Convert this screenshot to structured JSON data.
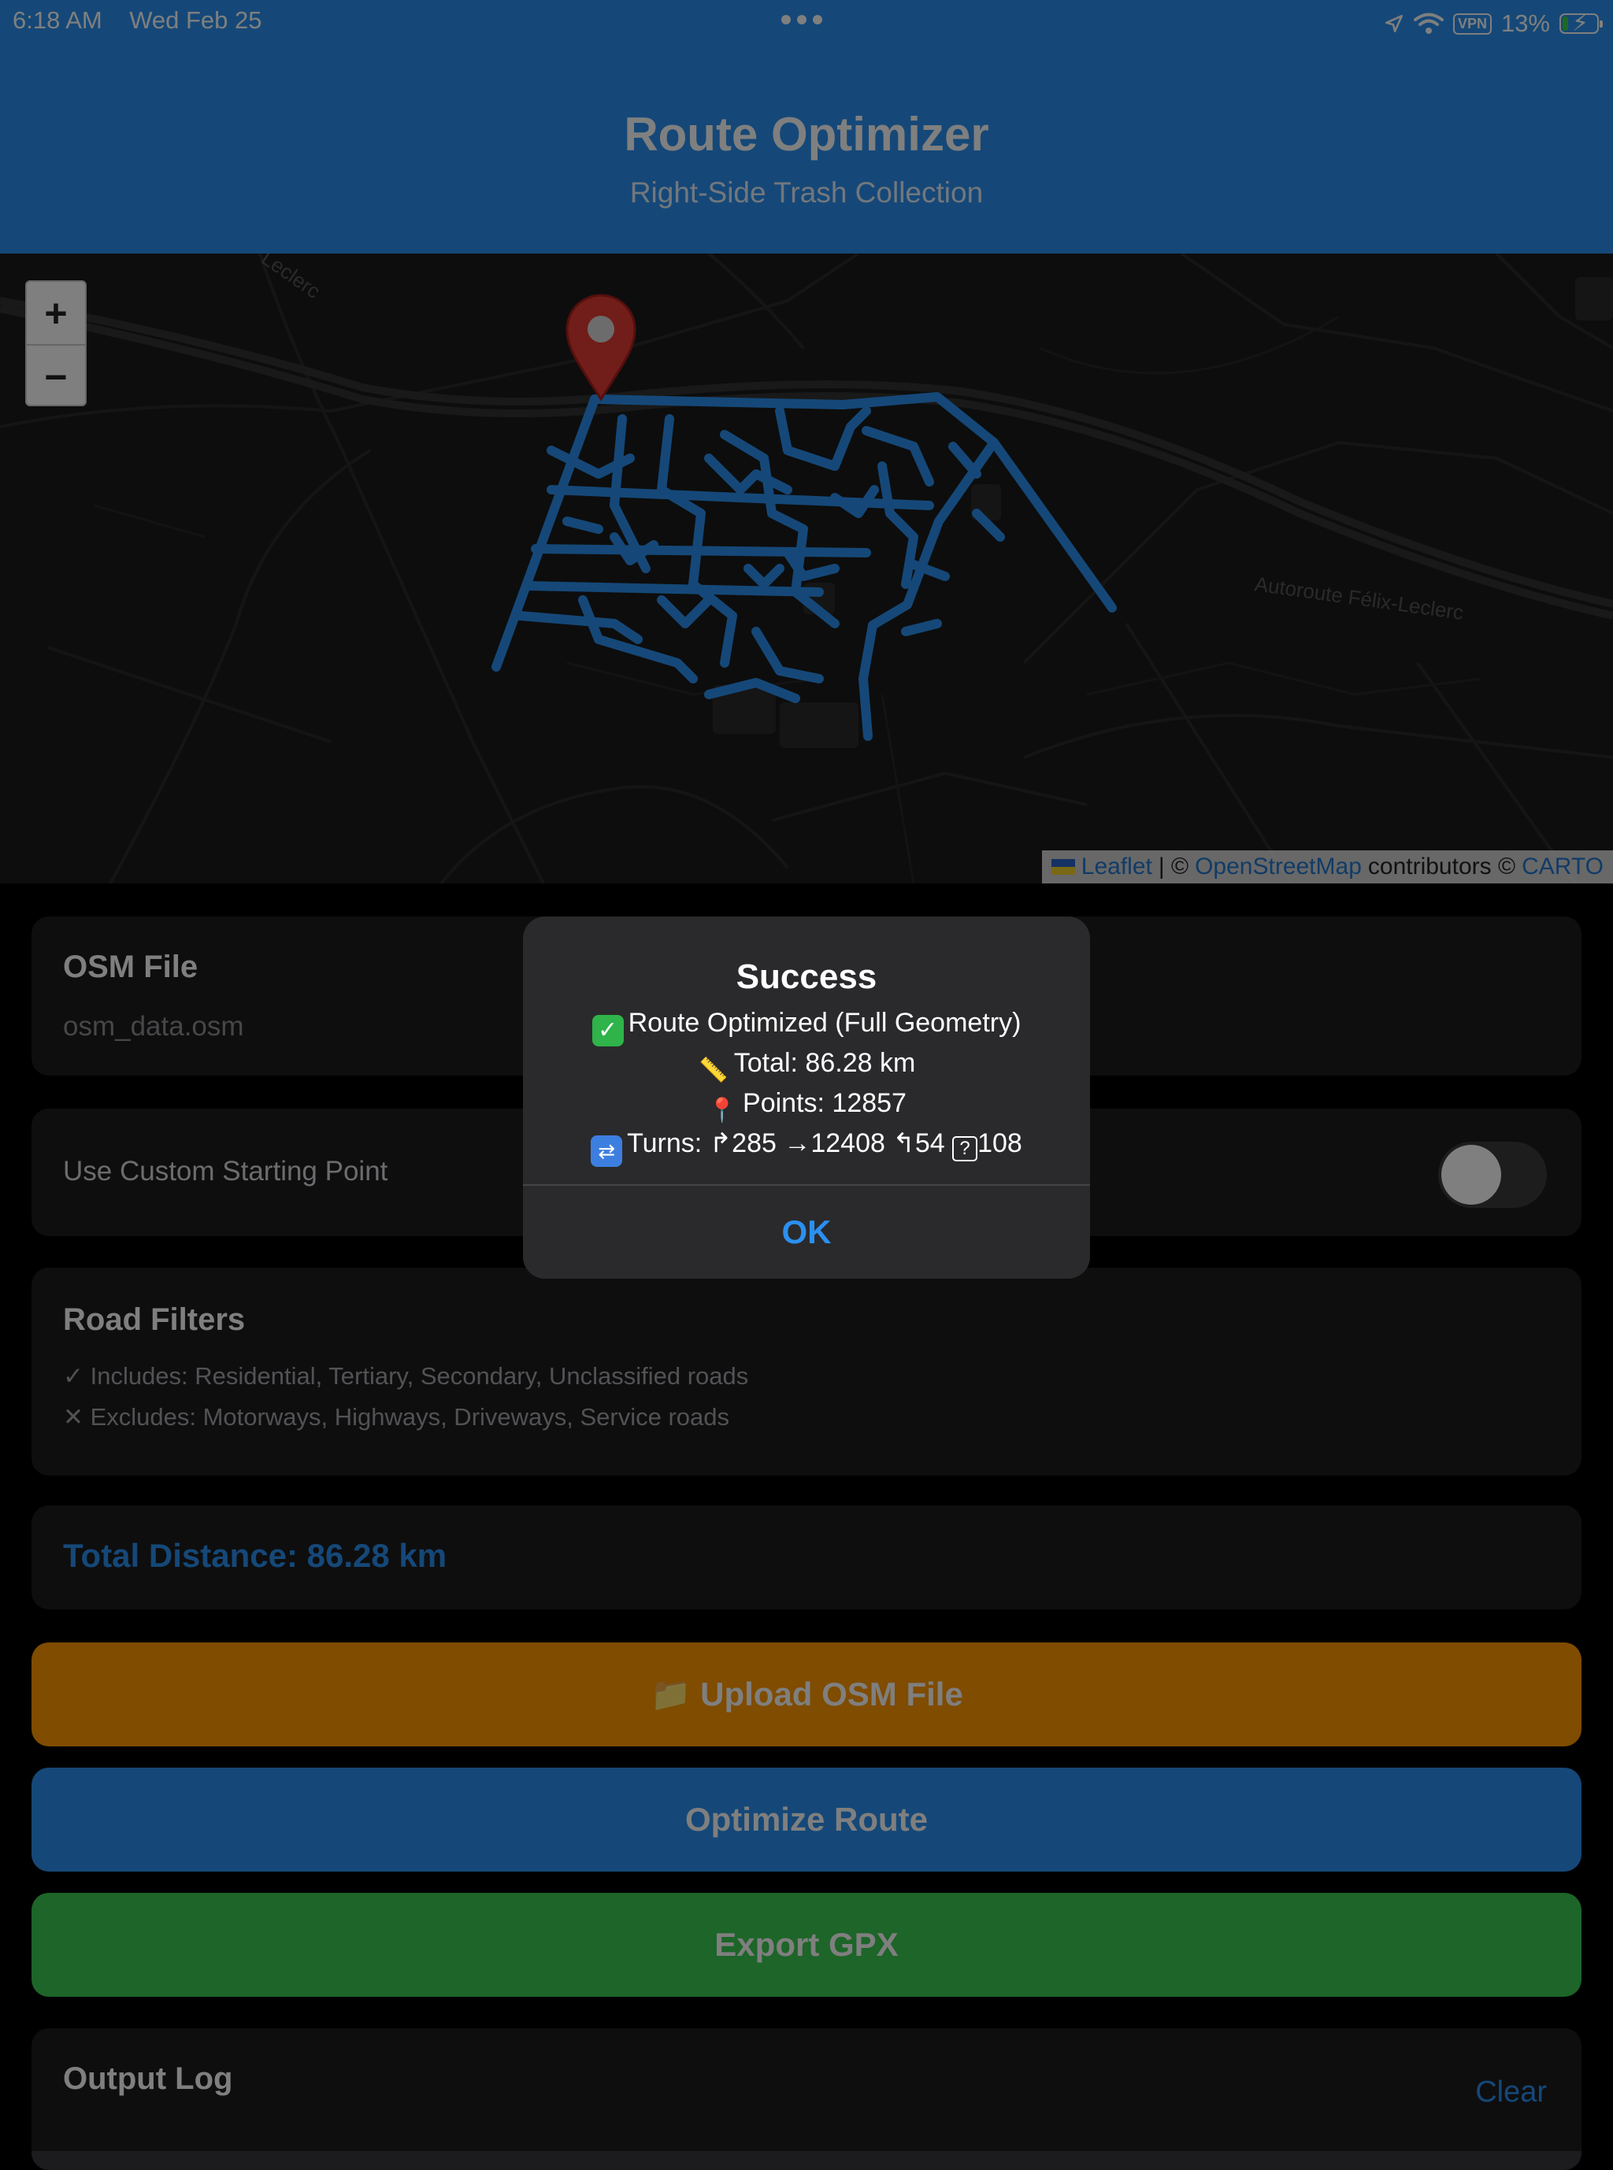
{
  "status": {
    "time": "6:18 AM",
    "date": "Wed Feb 25",
    "vpn": "VPN",
    "battery": "13%",
    "icons": [
      "location-arrow-icon",
      "wifi-icon",
      "battery-charging-icon"
    ]
  },
  "header": {
    "title": "Route Optimizer",
    "subtitle": "Right-Side Trash Collection"
  },
  "map": {
    "zoom_in": "+",
    "zoom_out": "−",
    "road_label": "Autoroute Félix-Leclerc",
    "road_label_short": "Leclerc",
    "attribution": {
      "leaflet": "Leaflet",
      "sep": "| ©",
      "osm": "OpenStreetMap",
      "contributors": "contributors ©",
      "carto": "CARTO"
    },
    "route_color": "#2b90f0",
    "marker_color": "#e33a32"
  },
  "osm_file": {
    "title": "OSM File",
    "value": "osm_data.osm"
  },
  "custom_start": {
    "label": "Use Custom Starting Point",
    "enabled": false
  },
  "road_filters": {
    "title": "Road Filters",
    "includes": "✓ Includes: Residential, Tertiary, Secondary, Unclassified roads",
    "excludes": "✕ Excludes: Motorways, Highways, Driveways, Service roads"
  },
  "total_distance": "Total Distance: 86.28 km",
  "buttons": {
    "upload": "📁 Upload OSM File",
    "optimize": "Optimize Route",
    "export": "Export GPX"
  },
  "output_log": {
    "title": "Output Log",
    "clear": "Clear"
  },
  "alert": {
    "title": "Success",
    "line1": "Route Optimized (Full Geometry)",
    "line2": "Total: 86.28 km",
    "line3": "Points: 12857",
    "line4": "Turns: ↱285 →12408 ↰54",
    "line4_unknown": "108",
    "ok": "OK"
  },
  "colors": {
    "accent": "#2b90f0",
    "upload": "#ff9900",
    "export": "#3bcb50",
    "card": "#1c1c1e"
  }
}
